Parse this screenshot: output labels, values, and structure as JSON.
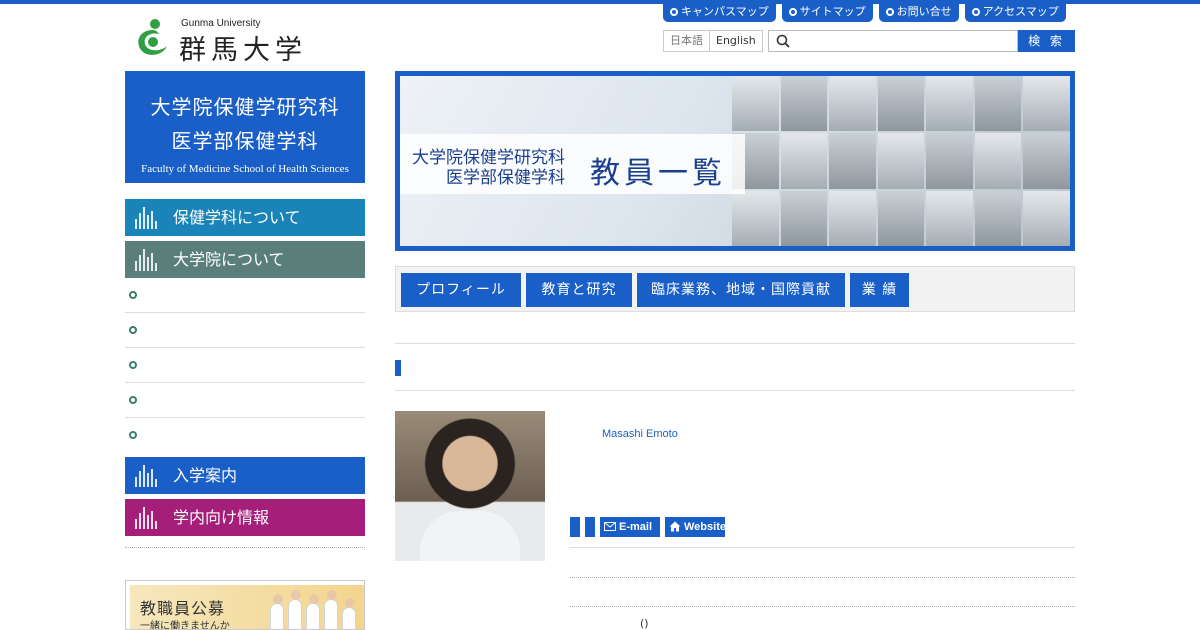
{
  "header": {
    "logo_en": "Gunma University",
    "logo_ja": "群馬大学",
    "util_nav": [
      "キャンパスマップ",
      "サイトマップ",
      "お問い合せ",
      "アクセスマップ"
    ],
    "lang": [
      "日本語",
      "English"
    ],
    "search_placeholder": "",
    "search_button": "検 索"
  },
  "sidebar": {
    "title_line1": "大学院保健学研究科",
    "title_line2": "医学部保健学科",
    "title_en": "Faculty of Medicine School of Health Sciences",
    "items": [
      {
        "label": "保健学科について",
        "color": "#1a84b8"
      },
      {
        "label": "大学院について",
        "color": "#5a7f7a"
      },
      {
        "label": "入学案内",
        "color": "#1a5fc8"
      },
      {
        "label": "学内向け情報",
        "color": "#a51f7a"
      }
    ],
    "sub_items": [
      "",
      "",
      "",
      "",
      ""
    ],
    "recruit_title": "教職員公募",
    "recruit_sub": "一緒に働きませんか"
  },
  "banner": {
    "line1": "大学院保健学研究科",
    "line2": "医学部保健学科",
    "title": "教員一覧"
  },
  "tabs": [
    "プロフィール",
    "教育と研究",
    "臨床業務、地域・国際貢献",
    "業 績"
  ],
  "profile": {
    "name_en": "Masashi Emoto",
    "email_label": "E-mail",
    "website_label": "Website",
    "paren": "()"
  },
  "colors": {
    "accent": "#1a5fc8"
  }
}
